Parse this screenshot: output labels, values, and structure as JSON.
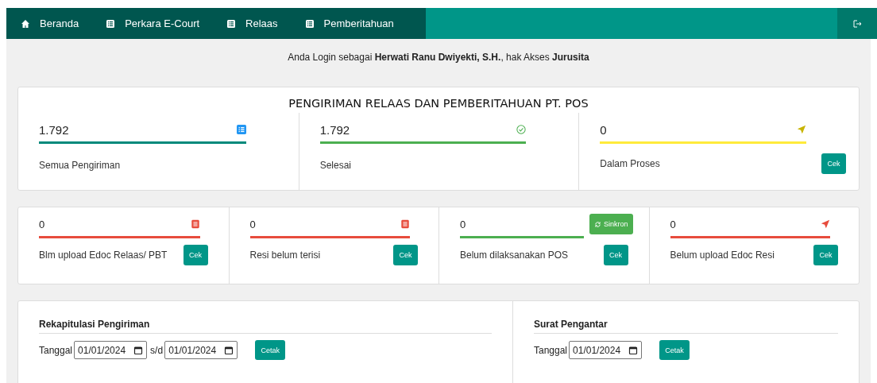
{
  "nav": {
    "items": [
      {
        "label": "Beranda",
        "kind": "home"
      },
      {
        "label": "Perkara E-Court",
        "kind": "list"
      },
      {
        "label": "Relaas",
        "kind": "list"
      },
      {
        "label": "Pemberitahuan",
        "kind": "list"
      }
    ]
  },
  "login": {
    "prefix": "Anda Login sebagai",
    "name": "Herwati Ranu Dwiyekti, S.H.",
    "middle": ", hak Akses",
    "role": "Jurusita"
  },
  "summary": {
    "title": "PENGIRIMAN RELAAS DAN PEMBERITAHUAN PT. POS",
    "stats": [
      {
        "value": "1.792",
        "label": "Semua Pengiriman",
        "kind": "list",
        "color": "#00897b"
      },
      {
        "value": "1.792",
        "label": "Selesai",
        "kind": "check",
        "color": "#4caf50"
      },
      {
        "value": "0",
        "label": "Dalam Proses",
        "kind": "send",
        "color": "#ffeb3b",
        "button": "Cek"
      }
    ]
  },
  "checks": {
    "stats": [
      {
        "value": "0",
        "label": "Blm upload Edoc Relaas/ PBT",
        "kind": "doc",
        "color": "#e74c3c",
        "button": "Cek"
      },
      {
        "value": "0",
        "label": "Resi belum terisi",
        "kind": "doc",
        "color": "#e74c3c",
        "button": "Cek"
      },
      {
        "value": "0",
        "label": "Belum dilaksanakan POS",
        "kind": "sync",
        "color": "#4caf50",
        "button": "Cek",
        "sync_button": "Sinkron"
      },
      {
        "value": "0",
        "label": "Belum upload Edoc Resi",
        "kind": "send",
        "color": "#e74c3c",
        "button": "Cek"
      }
    ]
  },
  "reports": [
    {
      "title": "Rekapitulasi Pengiriman",
      "date_label": "Tanggal",
      "from": "01/01/2024",
      "separator": "s/d",
      "to": "01/01/2024",
      "button": "Cetak"
    },
    {
      "title": "Surat Pengantar",
      "date_label": "Tanggal",
      "from": "01/01/2024",
      "button": "Cetak"
    }
  ]
}
